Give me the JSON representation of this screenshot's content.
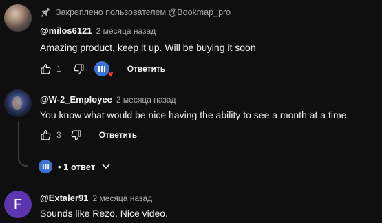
{
  "pinned": {
    "text": "Закреплено пользователем @Bookmap_pro",
    "icon": "pin-icon"
  },
  "comments": [
    {
      "author": "@milos6121",
      "time": "2 месяца назад",
      "text": "Amazing product, keep it up. Will be buying it soon",
      "likes": "1",
      "reply_label": "Ответить",
      "creator_heart": true
    },
    {
      "author": "@W-2_Employee",
      "time": "2 месяца назад",
      "text": "You know what would be nice having the ability to see a month at a time.",
      "likes": "3",
      "reply_label": "Ответить"
    },
    {
      "author": "@Extaler91",
      "time": "2 месяца назад",
      "text": "Sounds like Rezo. Nice video.",
      "avatar_letter": "F"
    }
  ],
  "replies_toggle": {
    "label": "• 1 ответ"
  },
  "colors": {
    "background": "#0f0f0f",
    "creator_badge": "#3a73d8",
    "heart": "#ff2d2d",
    "avatar_f": "#5e35b1"
  }
}
